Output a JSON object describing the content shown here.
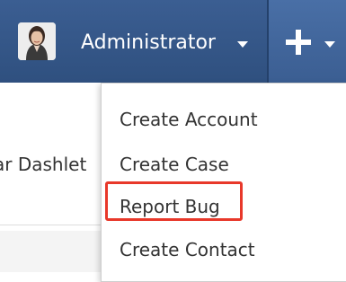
{
  "header": {
    "user_name": "Administrator",
    "avatar_icon": "user-avatar-icon",
    "user_menu_icon": "chevron-down-icon",
    "quick_create_icon": "plus-icon",
    "quick_create_menu_icon": "chevron-down-icon",
    "bar_color": "#34578a"
  },
  "background_page": {
    "partial_text": "ar Dashlet"
  },
  "quick_create_menu": {
    "items": [
      {
        "label": "Create Account"
      },
      {
        "label": "Create Case"
      },
      {
        "label": "Report Bug",
        "highlighted": true
      },
      {
        "label": "Create Contact"
      }
    ],
    "highlight_color": "#e8382a"
  }
}
